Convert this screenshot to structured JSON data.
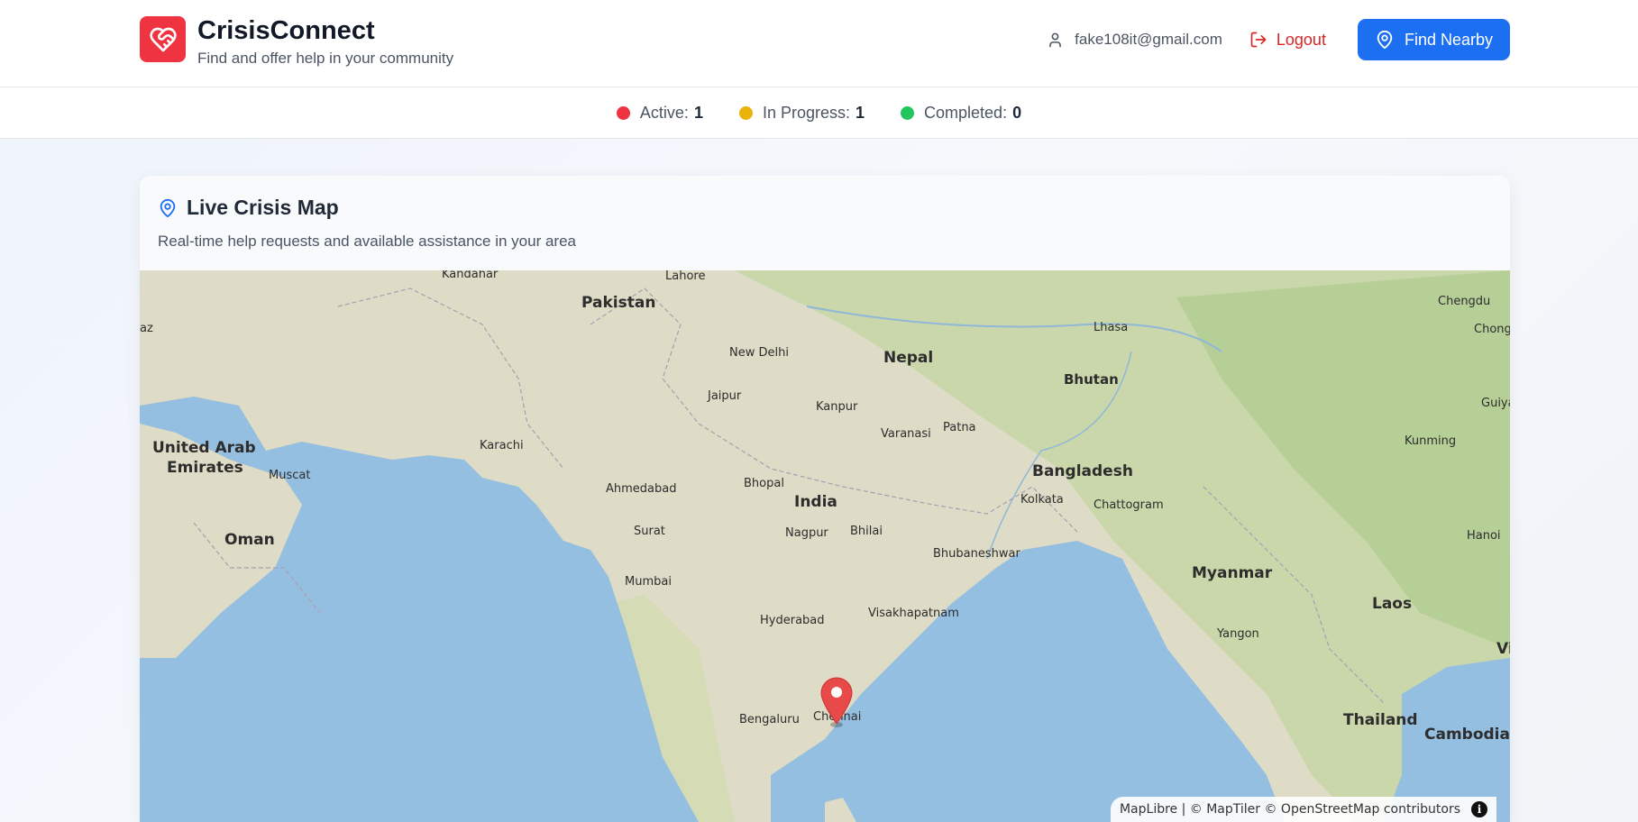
{
  "brand": {
    "title": "CrisisConnect",
    "subtitle": "Find and offer help in your community",
    "logo_icon": "heart-handshake-icon",
    "color": "#ef3340"
  },
  "header": {
    "user_email": "fake108it@gmail.com",
    "logout_label": "Logout",
    "find_nearby_label": "Find Nearby",
    "accent": "#1d6ff2"
  },
  "stats": [
    {
      "label": "Active:",
      "value": "1",
      "color": "#ef3340"
    },
    {
      "label": "In Progress:",
      "value": "1",
      "color": "#eab308"
    },
    {
      "label": "Completed:",
      "value": "0",
      "color": "#22c55e"
    }
  ],
  "map_card": {
    "title": "Live Crisis Map",
    "subtitle": "Real-time help requests and available assistance in your area"
  },
  "map": {
    "countries": [
      "Pakistan",
      "Nepal",
      "Bhutan",
      "India",
      "Bangladesh",
      "United Arab",
      "Emirates",
      "Oman",
      "Myanmar",
      "Laos",
      "Thailand",
      "Cambodia"
    ],
    "cities": [
      "Kandahar",
      "Lahore",
      "Chengdu",
      "Lhasa",
      "Chongq",
      "az",
      "New Delhi",
      "Jaipur",
      "Kanpur",
      "Guiya",
      "Varanasi",
      "Patna",
      "Kunming",
      "Karachi",
      "Muscat",
      "Ahmedabad",
      "Bhopal",
      "Kolkata",
      "Chattogram",
      "Surat",
      "Nagpur",
      "Bhilai",
      "Hanoi",
      "Bhubaneshwar",
      "Mumbai",
      "Hyderabad",
      "Visakhapatnam",
      "Yangon",
      "Vi",
      "Bengaluru",
      "Chennai"
    ],
    "marker_label": "Chennai",
    "attribution": "MapLibre | © MapTiler © OpenStreetMap contributors"
  }
}
